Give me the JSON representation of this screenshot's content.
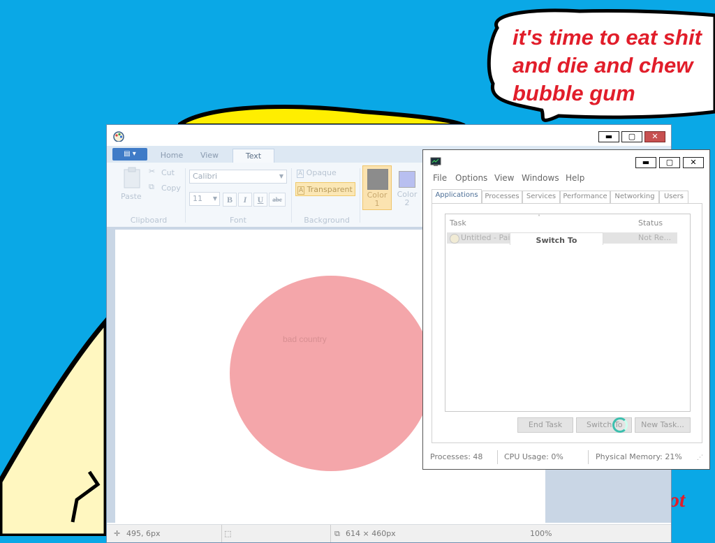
{
  "desktop": {
    "speech_bubble_text": "it's time to eat shit\nand die and chew\nbubble gum",
    "fragment_text": "ot"
  },
  "paint": {
    "menu_button_label": "▤ ▾",
    "tabs": [
      {
        "label": "Home",
        "active": false
      },
      {
        "label": "View",
        "active": false
      },
      {
        "label": "Text",
        "active": true
      }
    ],
    "clipboard": {
      "paste": "Paste",
      "cut": "Cut",
      "copy": "Copy",
      "group": "Clipboard"
    },
    "font": {
      "family": "Calibri",
      "size": "11",
      "bold": "B",
      "italic": "I",
      "underline": "U",
      "strike": "abc",
      "group": "Font"
    },
    "background": {
      "opaque": "Opaque",
      "transparent": "Transparent",
      "group": "Background"
    },
    "colors": {
      "color1_line1": "Color",
      "color1_line2": "1",
      "color2_line1": "Color",
      "color2_line2": "2",
      "color1_hex": "#8c8c8c",
      "color2_hex": "#b8bff0"
    },
    "canvas_text": "bad country",
    "circle_color": "#f4a6aa",
    "status": {
      "cursor_pos": "495, 6px",
      "canvas_size": "614 × 460px",
      "zoom": "100%"
    }
  },
  "taskmanager": {
    "menu": [
      "File",
      "Options",
      "View",
      "Windows",
      "Help"
    ],
    "tabs": [
      "Applications",
      "Processes",
      "Services",
      "Performance",
      "Networking",
      "Users"
    ],
    "columns": {
      "task": "Task",
      "status": "Status"
    },
    "row": {
      "task": "Untitled - Paint",
      "status": "Not Re..."
    },
    "context_menu_item": "Switch To",
    "buttons": {
      "end_task": "End Task",
      "switch_to": "Switch To",
      "new_task": "New Task..."
    },
    "status": {
      "processes": "Processes: 48",
      "cpu": "CPU Usage: 0%",
      "memory": "Physical Memory: 21%"
    }
  }
}
